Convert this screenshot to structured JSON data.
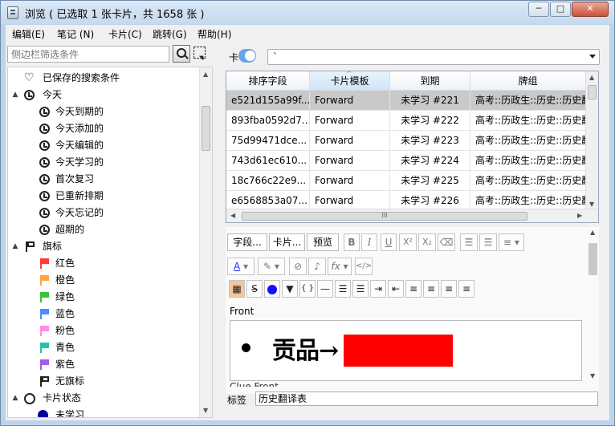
{
  "window": {
    "title": "浏览 ( 已选取 1 张卡片，共 1658 张 )",
    "minimize_label": "─",
    "maximize_label": "□",
    "close_label": "✕"
  },
  "menu": {
    "edit": "编辑(E)",
    "notes": "笔记 (N)",
    "cards": "卡片(C)",
    "goto": "跳转(G)",
    "help": "帮助(H)"
  },
  "sidebar": {
    "search_placeholder": "侧边栏筛选条件",
    "saved_searches": "已保存的搜索条件",
    "today": {
      "label": "今天",
      "items": [
        "今天到期的",
        "今天添加的",
        "今天编辑的",
        "今天学习的",
        "首次复习",
        "已重新排期",
        "今天忘记的",
        "超期的"
      ]
    },
    "flags": {
      "label": "旗标",
      "items": [
        {
          "label": "红色",
          "color": "#ff3b3b"
        },
        {
          "label": "橙色",
          "color": "#ffa640"
        },
        {
          "label": "绿色",
          "color": "#3bc13b"
        },
        {
          "label": "蓝色",
          "color": "#4a8cff"
        },
        {
          "label": "粉色",
          "color": "#ff8de8"
        },
        {
          "label": "青色",
          "color": "#1fc7aa"
        },
        {
          "label": "紫色",
          "color": "#a25bf0"
        },
        {
          "label": "无旗标",
          "color": "#222222"
        }
      ]
    },
    "card_state": {
      "label": "卡片状态",
      "items": [
        "未学习"
      ]
    }
  },
  "toolbar": {
    "mode_label": "卡",
    "search_value": "`"
  },
  "table": {
    "columns": [
      "排序字段",
      "卡片模板",
      "到期",
      "牌组"
    ],
    "sorted_column": 1,
    "rows": [
      {
        "sort": "e521d155a99f...",
        "template": "Forward",
        "due": "未学习 #221",
        "deck": "高考::历政生::历史::历史翻..."
      },
      {
        "sort": "893fba0592d7...",
        "template": "Forward",
        "due": "未学习 #222",
        "deck": "高考::历政生::历史::历史翻..."
      },
      {
        "sort": "75d99471dce...",
        "template": "Forward",
        "due": "未学习 #223",
        "deck": "高考::历政生::历史::历史翻..."
      },
      {
        "sort": "743d61ec610...",
        "template": "Forward",
        "due": "未学习 #224",
        "deck": "高考::历政生::历史::历史翻..."
      },
      {
        "sort": "18c766c22e9...",
        "template": "Forward",
        "due": "未学习 #225",
        "deck": "高考::历政生::历史::历史翻..."
      },
      {
        "sort": "e6568853a07...",
        "template": "Forward",
        "due": "未学习 #226",
        "deck": "高考::历政生::历史::历史翻..."
      }
    ],
    "selected_row": 0,
    "hscroll_grip": "III"
  },
  "editor": {
    "fields_button": "字段...",
    "cards_button": "卡片...",
    "preview_button": "预览",
    "format_buttons": {
      "bold": "B",
      "italic": "I",
      "underline": "U",
      "superscript": "X²",
      "subscript": "X₂",
      "math": "fx",
      "html": "</>",
      "strike": "S",
      "braces": "{ }",
      "caret": "▼"
    },
    "field_name": "Front",
    "field_content": "贡品→",
    "next_field_name": "Clue Front",
    "tags_label": "标签",
    "tags_value": "历史翻译表"
  }
}
